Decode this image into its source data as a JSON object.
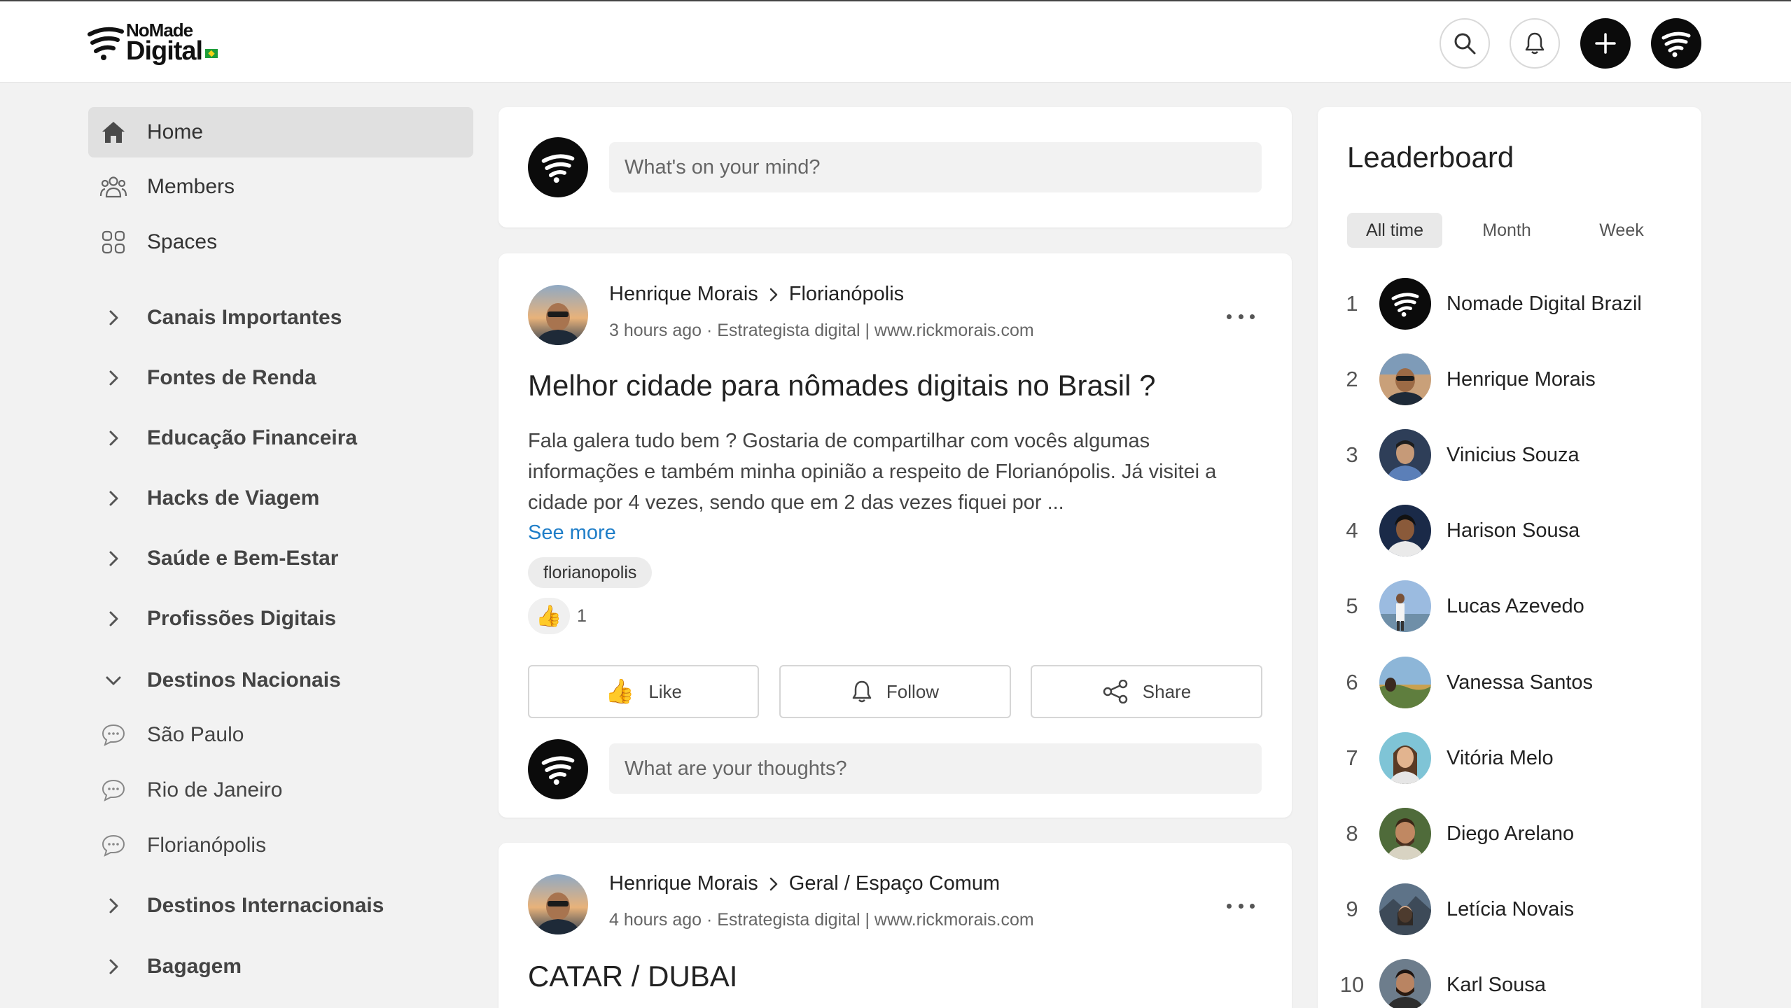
{
  "header": {
    "logo_line1": "NoMade",
    "logo_line2": "Digital",
    "icons": [
      "search-icon",
      "bell-icon",
      "plus-icon",
      "brand-avatar"
    ]
  },
  "sidebar": {
    "items": [
      {
        "label": "Home",
        "icon": "home-icon",
        "active": true
      },
      {
        "label": "Members",
        "icon": "members-icon"
      },
      {
        "label": "Spaces",
        "icon": "spaces-icon"
      },
      {
        "label": "Canais Importantes",
        "icon": "chevron-right-icon"
      },
      {
        "label": "Fontes de Renda",
        "icon": "chevron-right-icon"
      },
      {
        "label": "Educação Financeira",
        "icon": "chevron-right-icon"
      },
      {
        "label": "Hacks de Viagem",
        "icon": "chevron-right-icon"
      },
      {
        "label": "Saúde e Bem-Estar",
        "icon": "chevron-right-icon"
      },
      {
        "label": "Profissões Digitais",
        "icon": "chevron-right-icon"
      },
      {
        "label": "Destinos Nacionais",
        "icon": "chevron-down-icon"
      },
      {
        "label": "São Paulo",
        "icon": "chat-bubble-icon"
      },
      {
        "label": "Rio de Janeiro",
        "icon": "chat-bubble-icon"
      },
      {
        "label": "Florianópolis",
        "icon": "chat-bubble-icon"
      },
      {
        "label": "Destinos Internacionais",
        "icon": "chevron-right-icon"
      },
      {
        "label": "Bagagem",
        "icon": "chevron-right-icon"
      }
    ]
  },
  "composer": {
    "placeholder": "What's on your mind?"
  },
  "posts": [
    {
      "author": "Henrique Morais",
      "space": "Florianópolis",
      "meta": "3 hours ago · Estrategista digital | www.rickmorais.com",
      "title": "Melhor cidade para nômades digitais no Brasil ?",
      "body_lines": [
        "Fala galera tudo bem ? Gostaria de compartilhar com vocês algumas",
        "informações e também minha opinião a respeito de Florianópolis. Já visitei a",
        "cidade por 4 vezes, sendo que em 2 das vezes fiquei por ..."
      ],
      "see_more": "See more",
      "tag": "florianopolis",
      "reaction_count": "1",
      "actions": {
        "like": "Like",
        "follow": "Follow",
        "share": "Share"
      },
      "comment_placeholder": "What are your thoughts?"
    },
    {
      "author": "Henrique Morais",
      "space": "Geral / Espaço Comum",
      "meta": "4 hours ago · Estrategista digital | www.rickmorais.com",
      "title": "CATAR / DUBAI"
    }
  ],
  "leaderboard": {
    "title": "Leaderboard",
    "tabs": [
      "All time",
      "Month",
      "Week"
    ],
    "active_tab": "All time",
    "entries": [
      {
        "rank": "1",
        "name": "Nomade Digital Brazil"
      },
      {
        "rank": "2",
        "name": "Henrique Morais"
      },
      {
        "rank": "3",
        "name": "Vinicius Souza"
      },
      {
        "rank": "4",
        "name": "Harison Sousa"
      },
      {
        "rank": "5",
        "name": "Lucas Azevedo"
      },
      {
        "rank": "6",
        "name": "Vanessa Santos"
      },
      {
        "rank": "7",
        "name": "Vitória Melo"
      },
      {
        "rank": "8",
        "name": "Diego Arelano"
      },
      {
        "rank": "9",
        "name": "Letícia Novais"
      },
      {
        "rank": "10",
        "name": "Karl Sousa"
      }
    ]
  },
  "colors": {
    "brand": "#0b0b0b",
    "link": "#1f7ec8",
    "background": "#f2f2f2"
  }
}
